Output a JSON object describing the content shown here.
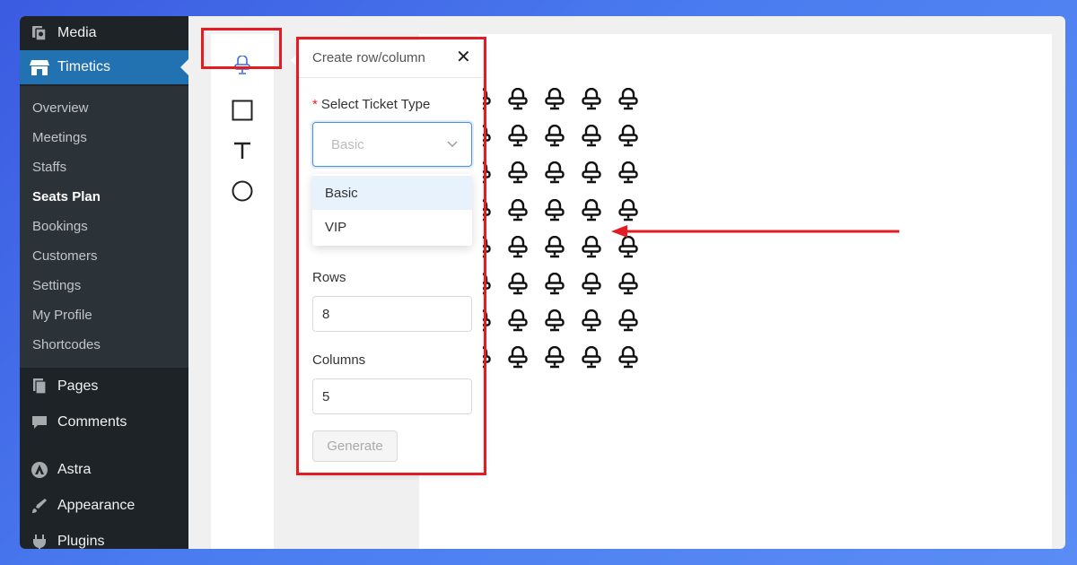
{
  "sidebar": {
    "top_items": [
      {
        "label": "Media",
        "icon": "media-icon"
      },
      {
        "label": "Timetics",
        "icon": "store-icon",
        "active": true
      }
    ],
    "submenu": [
      {
        "label": "Overview"
      },
      {
        "label": "Meetings"
      },
      {
        "label": "Staffs"
      },
      {
        "label": "Seats Plan",
        "current": true
      },
      {
        "label": "Bookings"
      },
      {
        "label": "Customers"
      },
      {
        "label": "Settings"
      },
      {
        "label": "My Profile"
      },
      {
        "label": "Shortcodes"
      }
    ],
    "bottom_items": [
      {
        "label": "Pages",
        "icon": "pages-icon"
      },
      {
        "label": "Comments",
        "icon": "comments-icon"
      },
      {
        "label": "Astra",
        "icon": "astra-icon"
      },
      {
        "label": "Appearance",
        "icon": "appearance-icon"
      },
      {
        "label": "Plugins",
        "icon": "plugins-icon"
      }
    ]
  },
  "tools": [
    "seat-tool-icon",
    "rectangle-tool-icon",
    "text-tool-icon",
    "circle-tool-icon"
  ],
  "popup": {
    "title": "Create row/column",
    "close": "✕",
    "ticket_label": "Select Ticket Type",
    "ticket_required_mark": "*",
    "ticket_placeholder": "Basic",
    "ticket_options": [
      "Basic",
      "VIP"
    ],
    "rows_label": "Rows",
    "rows_value": "8",
    "columns_label": "Columns",
    "columns_value": "5",
    "generate_label": "Generate"
  },
  "seat_grid": {
    "rows": 8,
    "visible_columns": 4
  },
  "colors": {
    "sidebar_bg": "#1d2327",
    "active_bg": "#2271b1",
    "highlight": "#e31b23",
    "accent": "#4a90e2"
  }
}
